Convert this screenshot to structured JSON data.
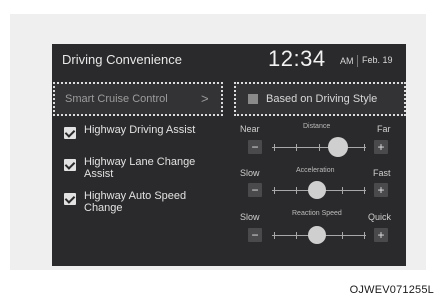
{
  "header": {
    "title": "Driving Convenience",
    "time": "12:34",
    "ampm": "AM",
    "date": "Feb. 19"
  },
  "left_panel": {
    "smart_cruise": {
      "label": "Smart Cruise Control",
      "chevron": ">"
    },
    "options": [
      {
        "label": "Highway Driving Assist",
        "checked": true
      },
      {
        "label": "Highway Lane Change Assist",
        "checked": true
      },
      {
        "label": "Highway Auto Speed Change",
        "checked": true
      }
    ]
  },
  "right_panel": {
    "driving_style": {
      "label": "Based on Driving Style",
      "checked": false
    },
    "sliders": [
      {
        "title": "Distance",
        "min_label": "Near",
        "max_label": "Far",
        "minus": "−",
        "plus": "+",
        "level": 0.82
      },
      {
        "title": "Acceleration",
        "min_label": "Slow",
        "max_label": "Fast",
        "minus": "−",
        "plus": "+",
        "level": 0.5
      },
      {
        "title": "Reaction Speed",
        "min_label": "Slow",
        "max_label": "Quick",
        "minus": "−",
        "plus": "+",
        "level": 0.5
      }
    ]
  },
  "caption": "OJWEV071255L",
  "colors": {
    "screen_bg": "#2a2a2c",
    "frame_bg": "#efefef",
    "text": "#e6e6e6"
  }
}
